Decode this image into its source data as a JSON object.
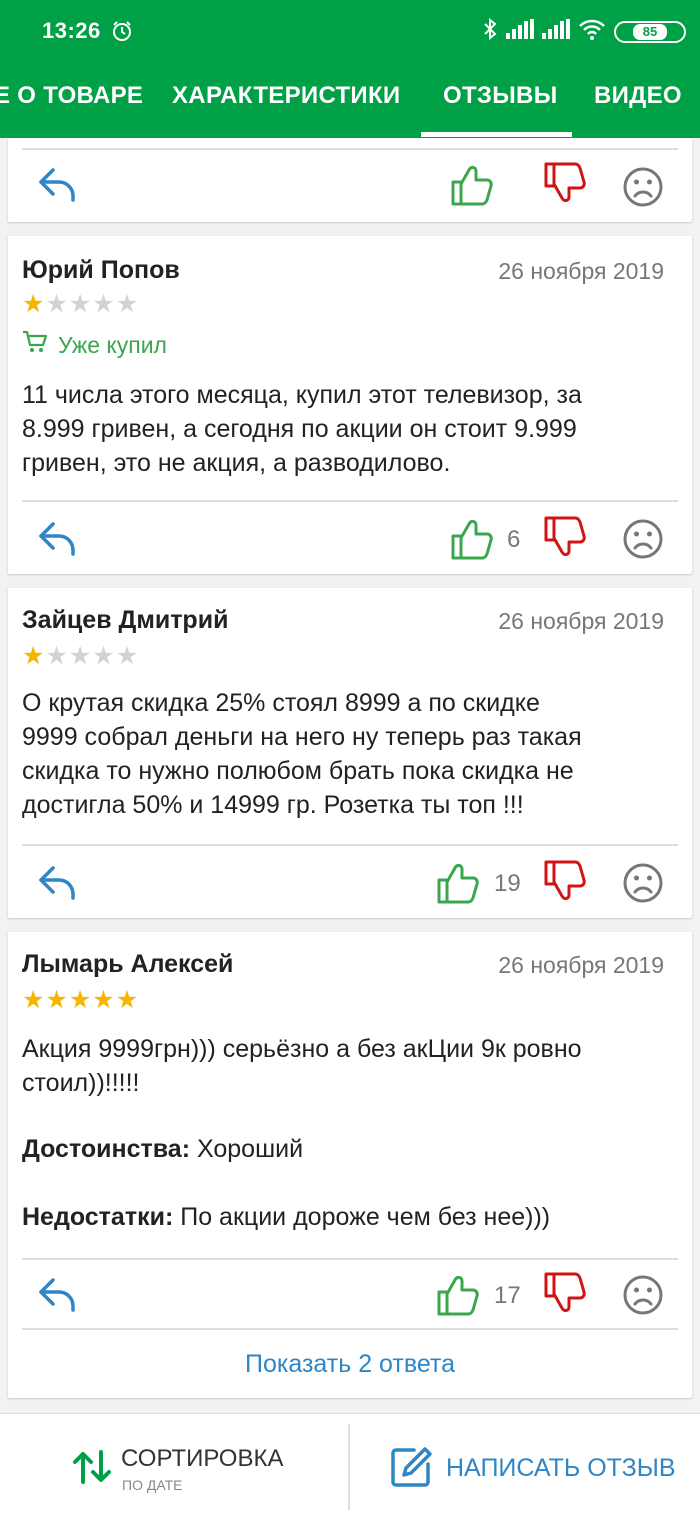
{
  "status_bar": {
    "time": "13:26",
    "battery": "85"
  },
  "tabs": [
    {
      "label": "Е О ТОВАРЕ"
    },
    {
      "label": "ХАРАКТЕРИСТИКИ"
    },
    {
      "label": "ОТЗЫВЫ",
      "active": true
    },
    {
      "label": "ВИДЕО"
    }
  ],
  "reviews": [
    {
      "author": "Юрий Попов",
      "date": "26 ноября 2019",
      "rating": 1,
      "bought_label": "Уже купил",
      "text_lines": [
        "11 числа этого месяца, купил этот телевизор, за",
        "8.999 гривен, а сегодня по акции он стоит 9.999",
        "гривен, это не акция, а разводилово."
      ],
      "likes": "6"
    },
    {
      "author": "Зайцев Дмитрий",
      "date": "26 ноября 2019",
      "rating": 1,
      "text_lines": [
        "О крутая скидка 25% стоял 8999 а по скидке",
        "9999 собрал деньги на него ну теперь раз такая",
        "скидка то нужно полюбом брать пока скидка не",
        "достигла 50% и 14999 гр. Розетка ты топ !!!"
      ],
      "likes": "19"
    },
    {
      "author": "Лымарь Алексей",
      "date": "26 ноября 2019",
      "rating": 5,
      "text_lines": [
        "Акция 9999грн))) серьёзно а без акЦии 9к ровно",
        "стоил))!!!!!"
      ],
      "pros_label": "Достоинства:",
      "pros_text": " Хороший",
      "cons_label": "Недостатки:",
      "cons_text": " По акции дороже чем без нее)))",
      "likes": "17",
      "show_replies": "Показать 2 ответа"
    }
  ],
  "bottom_bar": {
    "sort_label": "СОРТИРОВКА",
    "sort_sub": "ПО ДАТЕ",
    "write_label": "НАПИСАТЬ ОТЗЫВ"
  },
  "colors": {
    "brand_green": "#00a046",
    "like_green": "#3aa64d",
    "dislike_red": "#d01414",
    "link_blue": "#2f86c4",
    "star_gold": "#f7b500"
  }
}
